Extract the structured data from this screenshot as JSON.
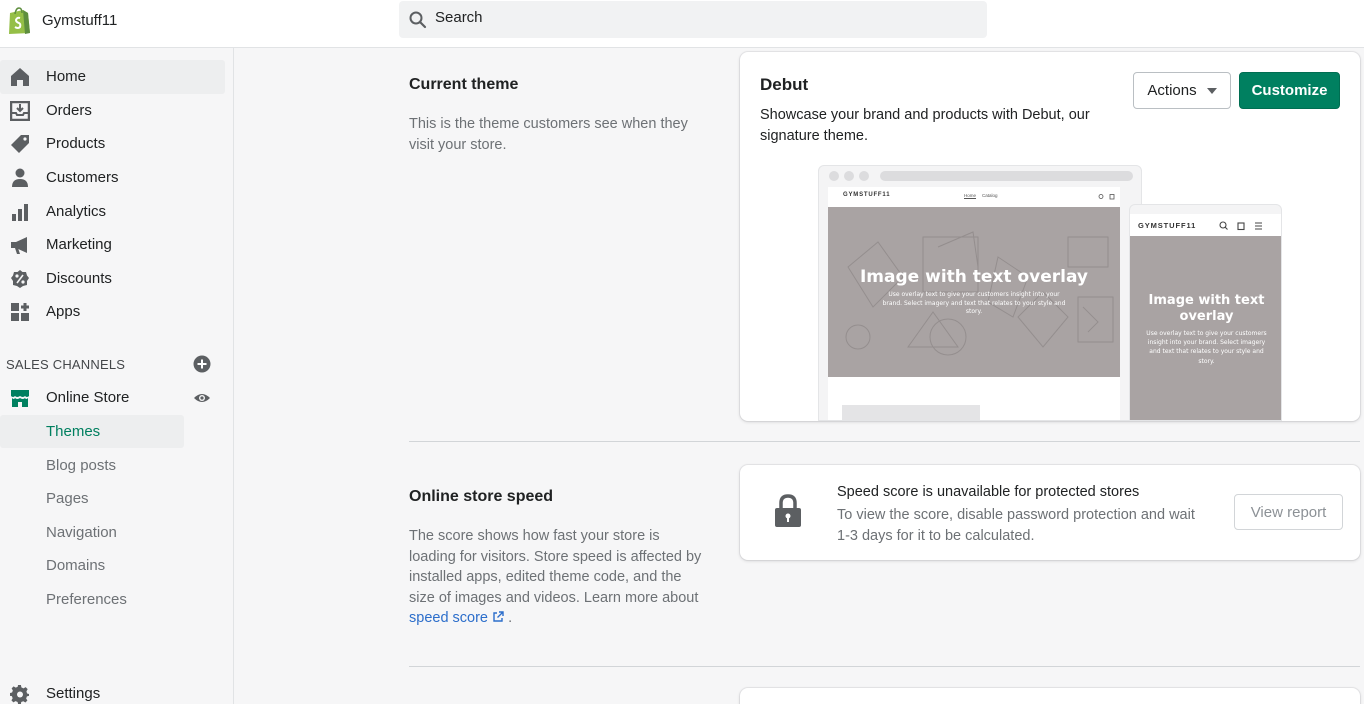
{
  "store": {
    "name": "Gymstuff11"
  },
  "search": {
    "placeholder": "Search"
  },
  "nav": {
    "items": [
      {
        "label": "Home"
      },
      {
        "label": "Orders"
      },
      {
        "label": "Products"
      },
      {
        "label": "Customers"
      },
      {
        "label": "Analytics"
      },
      {
        "label": "Marketing"
      },
      {
        "label": "Discounts"
      },
      {
        "label": "Apps"
      }
    ],
    "sales_channels_heading": "SALES CHANNELS",
    "online_store": "Online Store",
    "sub_items": [
      {
        "label": "Themes"
      },
      {
        "label": "Blog posts"
      },
      {
        "label": "Pages"
      },
      {
        "label": "Navigation"
      },
      {
        "label": "Domains"
      },
      {
        "label": "Preferences"
      }
    ],
    "settings": "Settings"
  },
  "current_theme": {
    "title": "Current theme",
    "description": "This is the theme customers see when they visit your store.",
    "theme_name": "Debut",
    "theme_description": "Showcase your brand and products with Debut, our signature theme.",
    "actions_label": "Actions",
    "customize_label": "Customize",
    "preview": {
      "store_label": "GYMSTUFF11",
      "nav_home": "Home",
      "nav_catalog": "Catalog",
      "overlay_title": "Image with text overlay",
      "overlay_text": "Use overlay text to give your customers insight into your brand. Select imagery and text that relates to your style and story.",
      "mobile_overlay_title": "Image with text overlay",
      "mobile_overlay_text": "Use overlay text to give your customers insight into your brand. Select imagery and text that relates to your style and story."
    }
  },
  "speed": {
    "title": "Online store speed",
    "description": "The score shows how fast your store is loading for visitors. Store speed is affected by installed apps, edited theme code, and the size of images and videos. Learn more about",
    "link_label": "speed score",
    "link_suffix": ".",
    "card_title": "Speed score is unavailable for protected stores",
    "card_text": "To view the score, disable password protection and wait 1-3 days for it to be calculated.",
    "view_report_label": "View report"
  },
  "colors": {
    "brand_green": "#008060",
    "active_sub": "#007f5f",
    "link": "#2c6ecb"
  }
}
